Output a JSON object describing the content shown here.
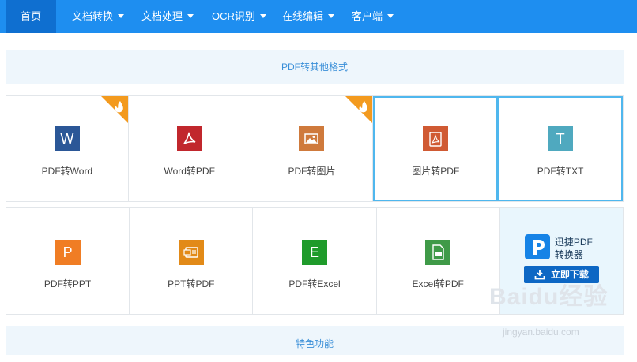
{
  "nav": {
    "home": "首页",
    "items": [
      "文档转换",
      "文档处理",
      "OCR识别",
      "在线编辑",
      "客户端"
    ]
  },
  "sections": {
    "top_title": "PDF转其他格式",
    "bottom_title": "特色功能"
  },
  "tiles_row1": [
    {
      "label": "PDF转Word",
      "icon": "word-icon",
      "glyph": "W",
      "color": "#2b5797",
      "hot": true
    },
    {
      "label": "Word转PDF",
      "icon": "acrobat-icon",
      "color": "#c1272d",
      "hot": false
    },
    {
      "label": "PDF转图片",
      "icon": "image-icon",
      "color": "#cf7a3c",
      "hot": true
    },
    {
      "label": "图片转PDF",
      "icon": "pdf-file-icon",
      "color": "#d05a33",
      "hot": false
    },
    {
      "label": "PDF转TXT",
      "icon": "text-icon",
      "glyph": "T",
      "color": "#4fa9bf",
      "hot": false
    }
  ],
  "tiles_row2": [
    {
      "label": "PDF转PPT",
      "icon": "powerpoint-icon",
      "glyph": "P",
      "color": "#f07d24"
    },
    {
      "label": "PPT转PDF",
      "icon": "ppt-pdf-icon",
      "color": "#e28a18"
    },
    {
      "label": "PDF转Excel",
      "icon": "excel-icon",
      "glyph": "E",
      "color": "#1f9b2b"
    },
    {
      "label": "Excel转PDF",
      "icon": "excel-pdf-icon",
      "color": "#3f9a48"
    }
  ],
  "promo": {
    "title_line1": "迅捷PDF",
    "title_line2": "转换器",
    "download": "立即下载"
  },
  "watermark": {
    "brand": "Baidu经验",
    "url": "jingyan.baidu.com"
  }
}
